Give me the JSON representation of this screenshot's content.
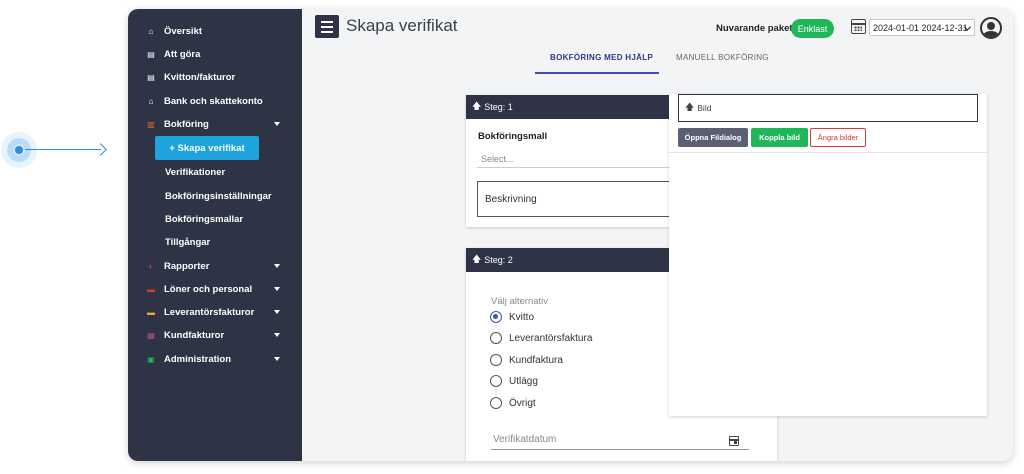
{
  "sidebar": {
    "items": [
      {
        "label": "Översikt",
        "icon": "home-icon",
        "icon_glyph": "⌂",
        "icon_color": "#ffffff",
        "has_caret": false
      },
      {
        "label": "Att göra",
        "icon": "todo-list-icon",
        "icon_glyph": "▤",
        "icon_color": "#ffffff",
        "has_caret": false
      },
      {
        "label": "Kvitton/fakturor",
        "icon": "receipt-icon",
        "icon_glyph": "▤",
        "icon_color": "#ffffff",
        "has_caret": false
      },
      {
        "label": "Bank och skattekonto",
        "icon": "bank-icon",
        "icon_glyph": "⌂",
        "icon_color": "#ffffff",
        "has_caret": false
      },
      {
        "label": "Bokföring",
        "icon": "ledger-icon",
        "icon_glyph": "▥",
        "icon_color": "#e06c2b",
        "has_caret": true
      }
    ],
    "sub_items": {
      "active": "+ Skapa verifikat",
      "verifikationer": "Verifikationer",
      "installningar": "Bokföringsinställningar",
      "mallar": "Bokföringsmallar",
      "tillgangar": "Tillgångar"
    },
    "lower_items": [
      {
        "label": "Rapporter",
        "icon": "reports-icon",
        "icon_glyph": "◐",
        "icon_color": "#d83a3a"
      },
      {
        "label": "Löner och personal",
        "icon": "payroll-icon",
        "icon_glyph": "▬",
        "icon_color": "#d83a3a"
      },
      {
        "label": "Leverantörsfakturor",
        "icon": "supplier-invoice-icon",
        "icon_glyph": "▬",
        "icon_color": "#e0b020"
      },
      {
        "label": "Kundfakturor",
        "icon": "customer-invoice-icon",
        "icon_glyph": "▤",
        "icon_color": "#e05a8a"
      },
      {
        "label": "Administration",
        "icon": "admin-icon",
        "icon_glyph": "▣",
        "icon_color": "#20b65a"
      }
    ]
  },
  "header": {
    "title": "Skapa verifikat",
    "package_label": "Nuvarande paket",
    "package_badge": "Enklast",
    "date_range": "2024-01-01 2024-12-31"
  },
  "tabs": {
    "help": "BOKFÖRING MED HJÄLP",
    "manual": "MANUELL BOKFÖRING"
  },
  "step1": {
    "heading": "Steg: 1",
    "template_label": "Bokföringsmall",
    "select_placeholder": "Select...",
    "description_placeholder": "Beskrivning"
  },
  "step2": {
    "heading": "Steg: 2",
    "choose_label": "Välj alternativ",
    "options": [
      "Kvitto",
      "Leverantörsfaktura",
      "Kundfaktura",
      "Utlägg",
      "Övrigt"
    ],
    "selected": "Kvitto",
    "date_placeholder": "Verifikatdatum"
  },
  "image_panel": {
    "field_label": "Bild",
    "open_button": "Öppna Fildialog",
    "link_button": "Koppla bild",
    "undo_button": "Ångra bilder"
  },
  "colors": {
    "sidebar_bg": "#2e3445",
    "active_item": "#1ea3dc",
    "accent": "#3f51b5",
    "success": "#20b65a",
    "danger": "#d83a3a"
  }
}
